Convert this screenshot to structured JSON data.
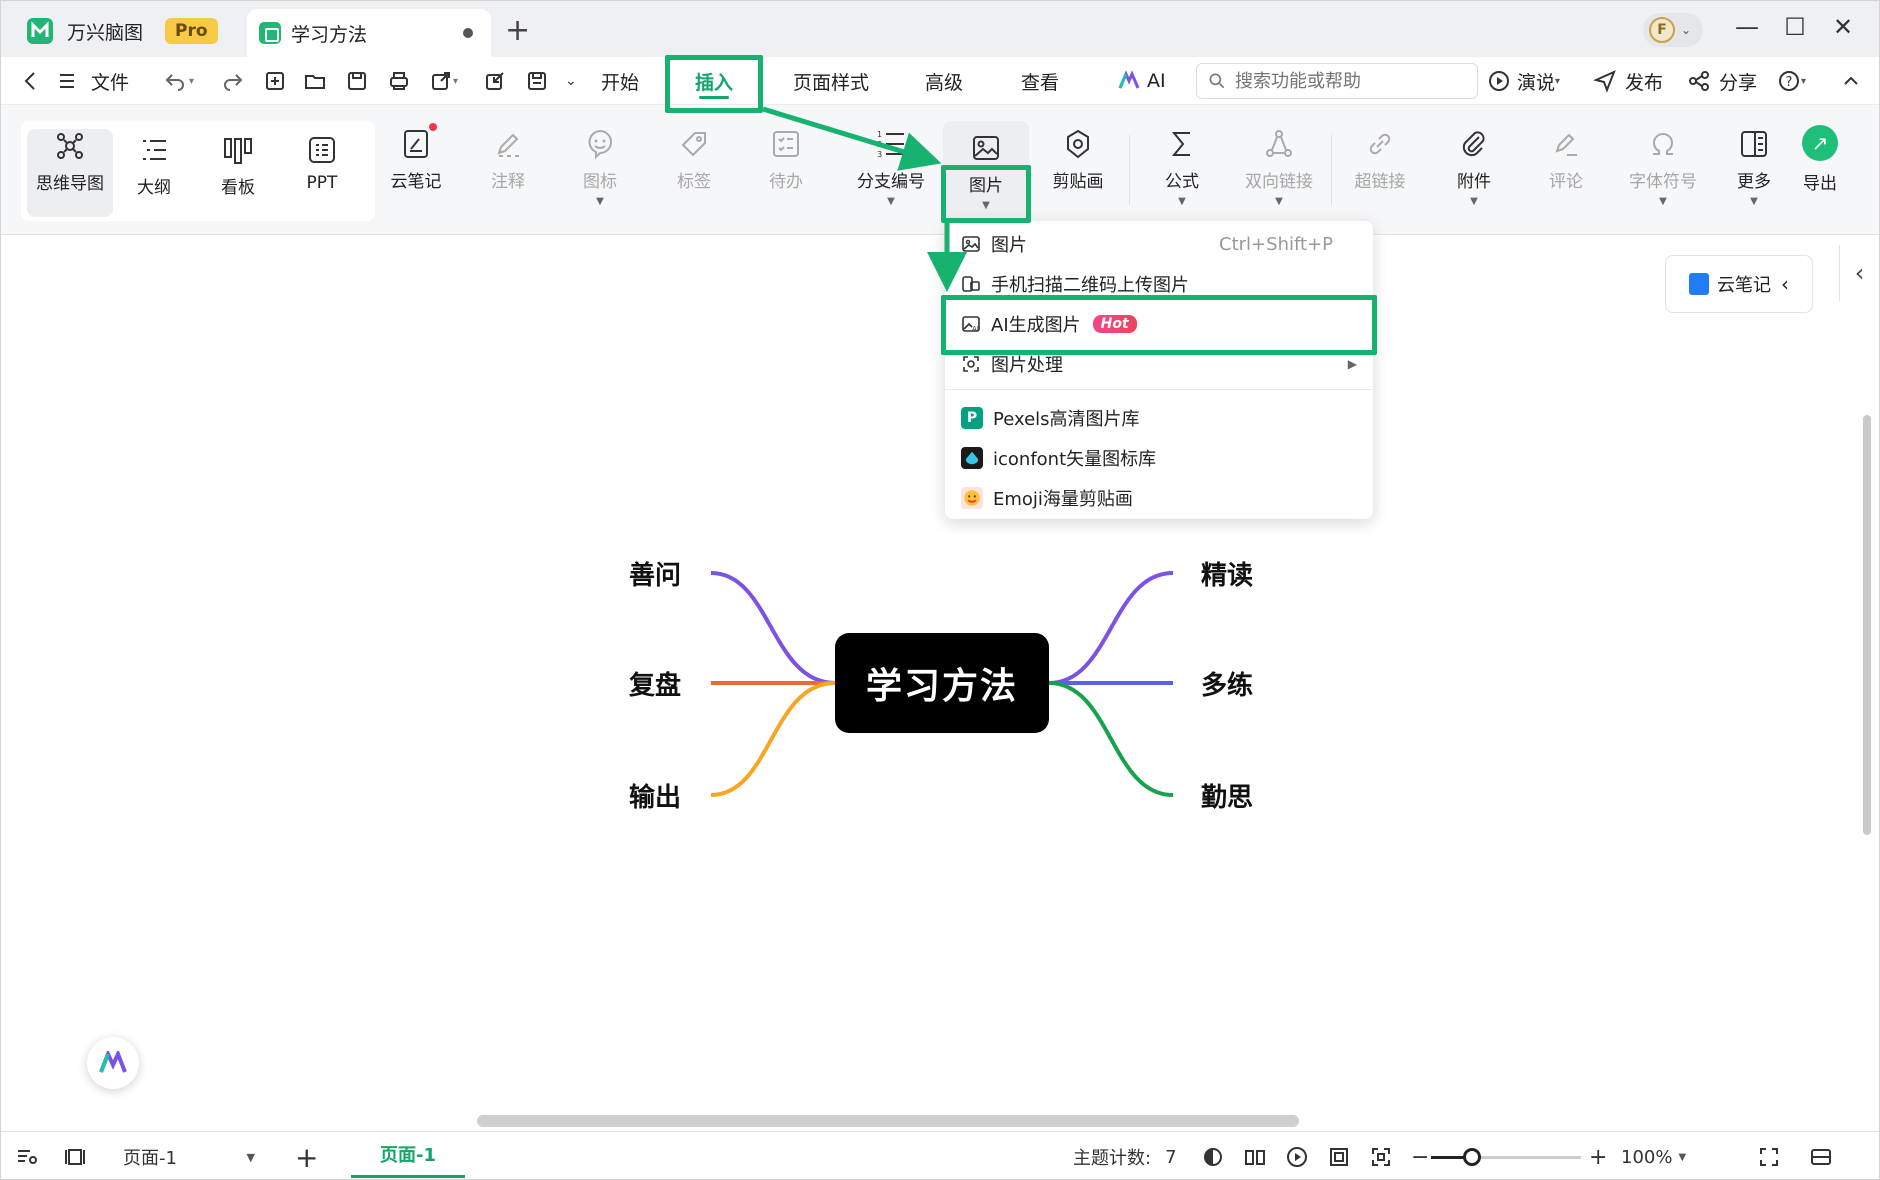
{
  "titlebar": {
    "app_name": "万兴脑图",
    "pro_badge": "Pro",
    "doc_tab": "学习方法",
    "new_tab": "+",
    "avatar_letter": "F"
  },
  "menubar": {
    "file": "文件",
    "start": "开始",
    "insert": "插入",
    "page_style": "页面样式",
    "advanced": "高级",
    "view": "查看",
    "ai": "AI",
    "search_placeholder": "搜索功能或帮助",
    "present": "演说",
    "publish": "发布",
    "share": "分享"
  },
  "ribbon": {
    "mindmap": "思维导图",
    "outline": "大纲",
    "board": "看板",
    "ppt": "PPT",
    "cloud_note": "云笔记",
    "note": "注释",
    "icon": "图标",
    "tag": "标签",
    "todo": "待办",
    "numbering": "分支编号",
    "image": "图片",
    "clipart": "剪贴画",
    "formula": "公式",
    "bilink": "双向链接",
    "hyperlink": "超链接",
    "attachment": "附件",
    "comment": "评论",
    "symbol": "字体符号",
    "more": "更多",
    "export": "导出"
  },
  "dropdown": {
    "image": "图片",
    "image_shortcut": "Ctrl+Shift+P",
    "scan": "手机扫描二维码上传图片",
    "ai_gen": "AI生成图片",
    "hot": "Hot",
    "process": "图片处理",
    "pexels": "Pexels高清图片库",
    "pexels_icon": "P",
    "iconfont": "iconfont矢量图标库",
    "emoji": "Emoji海量剪贴画"
  },
  "mindmap": {
    "center": "学习方法",
    "left": [
      "善问",
      "复盘",
      "输出"
    ],
    "right": [
      "精读",
      "多练",
      "勤思"
    ],
    "colors": {
      "left_top": "#7b52e6",
      "left_mid": "#ee6a2e",
      "left_bot": "#f5a623",
      "right_top": "#7b52e6",
      "right_mid": "#5b5ef0",
      "right_bot": "#17a34a"
    }
  },
  "canvas": {
    "cloud_note_panel": "云笔记"
  },
  "statusbar": {
    "page_select": "页面-1",
    "page_tab": "页面-1",
    "topic_count_label": "主题计数:",
    "topic_count": "7",
    "zoom": "100%"
  },
  "accent": "#17b270"
}
